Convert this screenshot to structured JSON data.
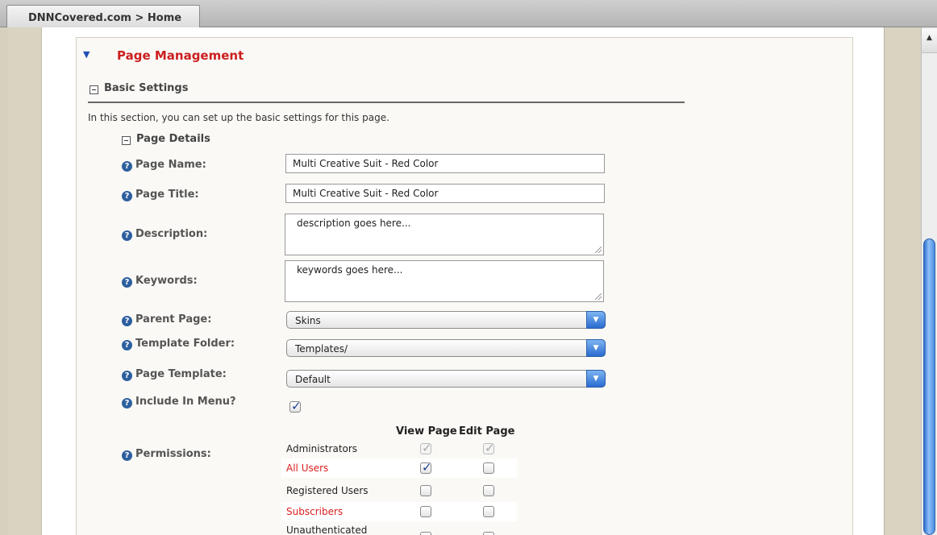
{
  "breadcrumb": {
    "label": "DNNCovered.com > Home"
  },
  "panel": {
    "title": "Page Management"
  },
  "basic_settings": {
    "title": "Basic Settings",
    "intro": "In this section, you can set up the basic settings for this page.",
    "details_title": "Page Details"
  },
  "fields": {
    "page_name": {
      "label": "Page Name:",
      "value": "Multi Creative Suit - Red Color"
    },
    "page_title": {
      "label": "Page Title:",
      "value": "Multi Creative Suit - Red Color"
    },
    "description": {
      "label": "Description:",
      "value": "description goes here..."
    },
    "keywords": {
      "label": "Keywords:",
      "value": "keywords goes here..."
    },
    "parent_page": {
      "label": "Parent Page:",
      "value": "Skins"
    },
    "template_folder": {
      "label": "Template Folder:",
      "value": "Templates/"
    },
    "page_template": {
      "label": "Page Template:",
      "value": "Default"
    },
    "include_in_menu": {
      "label": "Include In Menu?",
      "checked": true
    }
  },
  "permissions": {
    "label": "Permissions:",
    "columns": [
      "View Page",
      "Edit Page"
    ],
    "rows": [
      {
        "role": "Administrators",
        "view": "disabled-checked",
        "edit": "disabled-checked",
        "color": "#222222"
      },
      {
        "role": "All Users",
        "view": "checked",
        "edit": "unchecked",
        "color": "#dd1e1e"
      },
      {
        "role": "Registered Users",
        "view": "unchecked",
        "edit": "unchecked",
        "color": "#222222"
      },
      {
        "role": "Subscribers",
        "view": "unchecked",
        "edit": "unchecked",
        "color": "#dd1e1e"
      },
      {
        "role": "Unauthenticated",
        "view": "unchecked",
        "edit": "unchecked",
        "color": "#222222"
      }
    ]
  },
  "colors": {
    "accent_red": "#cc1f1f",
    "help_blue": "#2d5f9e",
    "select_blue": "#2a6bd0"
  }
}
